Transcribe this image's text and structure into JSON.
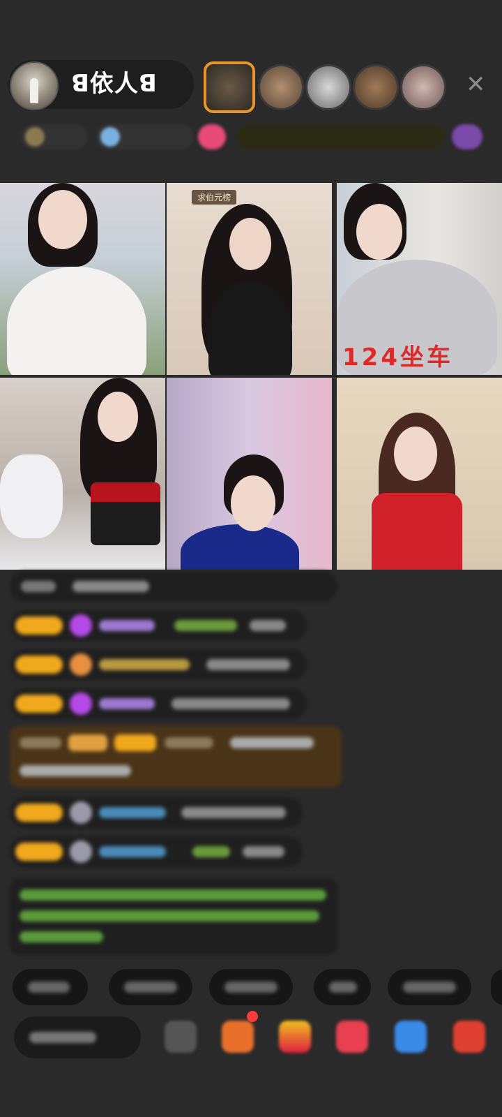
{
  "host": {
    "name": "ꓭ依人ꓭ"
  },
  "grid": {
    "cells": [
      {
        "id": "seat-1",
        "badge": "",
        "caption": ""
      },
      {
        "id": "seat-2",
        "badge": "求伯元榜",
        "caption": ""
      },
      {
        "id": "seat-3",
        "badge": "",
        "caption": "124坐车"
      },
      {
        "id": "seat-4",
        "badge": "",
        "caption": ""
      },
      {
        "id": "seat-5",
        "badge": "",
        "caption": ""
      },
      {
        "id": "seat-6",
        "badge": "",
        "caption": ""
      }
    ]
  },
  "colors": {
    "background": "#2a2a2a",
    "level_badge": "#f0a81c",
    "highlight": "#4a3418",
    "caption_red": "#e02828",
    "notice_text": "#6fbf3a"
  },
  "icons": [
    "close-icon",
    "gem-icon",
    "emoji-icon",
    "gift-icon"
  ]
}
